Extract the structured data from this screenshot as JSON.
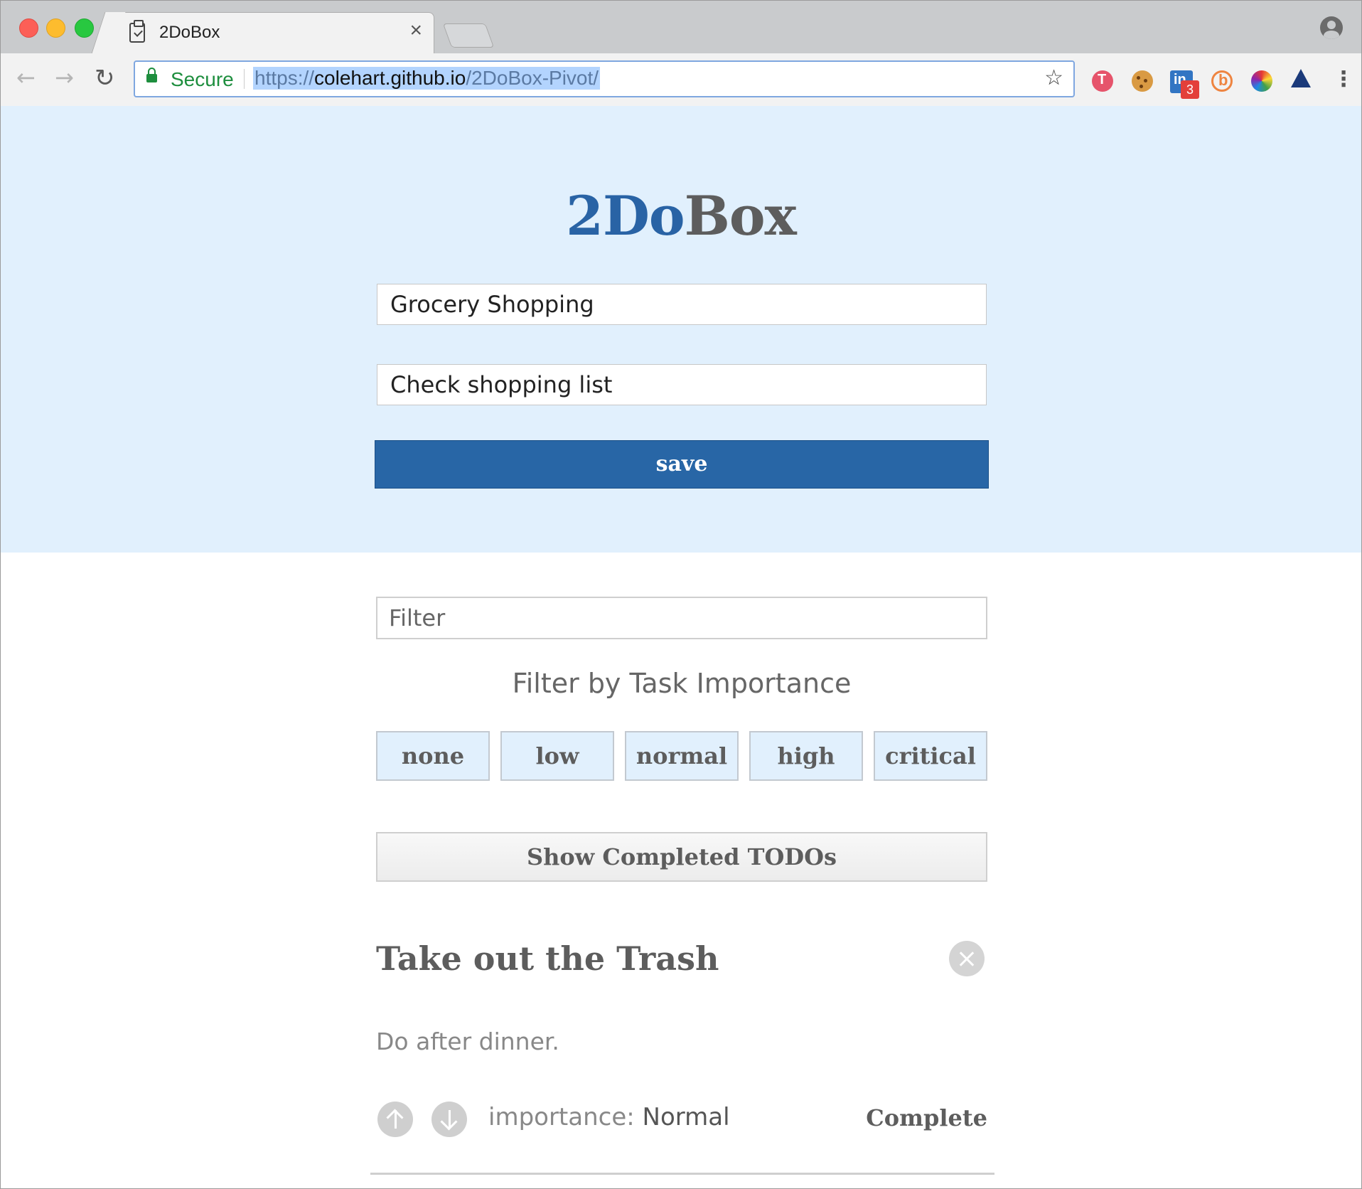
{
  "browser": {
    "tab_title": "2DoBox",
    "tab_close": "×",
    "secure_label": "Secure",
    "url_scheme": "https://",
    "url_host": "colehart.github.io",
    "url_path": "/2DoBox-Pivot/",
    "extension_badge": "3"
  },
  "app": {
    "title_part1": "2Do",
    "title_part2": "Box",
    "title_input_value": "Grocery Shopping",
    "body_input_value": "Check shopping list",
    "save_label": "save"
  },
  "filter": {
    "placeholder": "Filter",
    "heading": "Filter by Task Importance",
    "importance_buttons": [
      "none",
      "low",
      "normal",
      "high",
      "critical"
    ],
    "show_completed_label": "Show Completed TODOs"
  },
  "todos": [
    {
      "title": "Take out the Trash",
      "body": "Do after dinner.",
      "importance_label": "importance:",
      "importance_value": "Normal",
      "complete_label": "Complete"
    }
  ],
  "colors": {
    "hero_bg": "#e1f0fd",
    "accent_blue": "#2866a6",
    "text_gray": "#5d5d5d"
  }
}
